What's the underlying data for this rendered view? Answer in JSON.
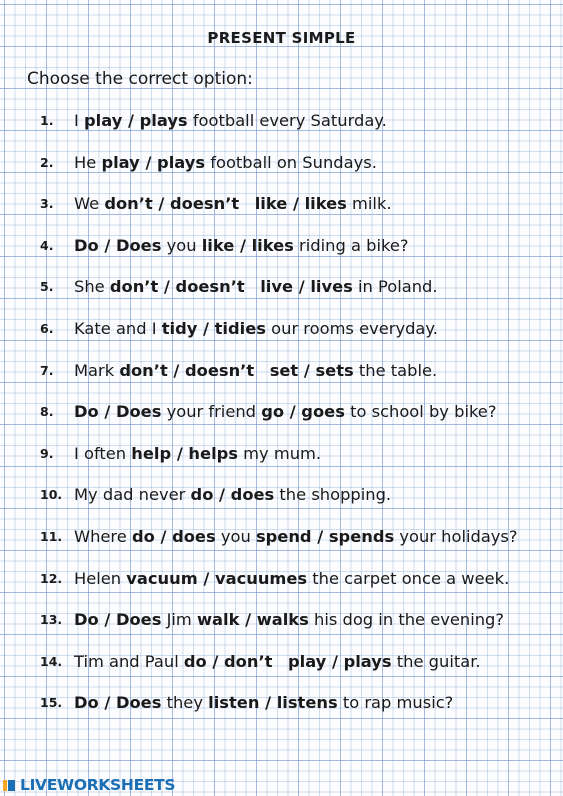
{
  "title": "PRESENT SIMPLE",
  "instruction": "Choose the correct option:",
  "exercises": [
    {
      "num": "1.",
      "parts": [
        {
          "t": "I "
        },
        {
          "t": "play / plays",
          "b": true
        },
        {
          "t": " football every Saturday."
        }
      ]
    },
    {
      "num": "2.",
      "parts": [
        {
          "t": "He "
        },
        {
          "t": "play / plays",
          "b": true
        },
        {
          "t": " football on Sundays."
        }
      ]
    },
    {
      "num": "3.",
      "parts": [
        {
          "t": "We "
        },
        {
          "t": "don’t / doesn’t",
          "b": true
        },
        {
          "t": "   "
        },
        {
          "t": "like / likes",
          "b": true
        },
        {
          "t": " milk."
        }
      ]
    },
    {
      "num": "4.",
      "parts": [
        {
          "t": "Do / Does",
          "b": true
        },
        {
          "t": " you "
        },
        {
          "t": "like / likes",
          "b": true
        },
        {
          "t": " riding a bike?"
        }
      ]
    },
    {
      "num": "5.",
      "parts": [
        {
          "t": "She "
        },
        {
          "t": "don’t / doesn’t",
          "b": true
        },
        {
          "t": "   "
        },
        {
          "t": "live / lives",
          "b": true
        },
        {
          "t": " in Poland."
        }
      ]
    },
    {
      "num": "6.",
      "parts": [
        {
          "t": "Kate and I "
        },
        {
          "t": "tidy / tidies",
          "b": true
        },
        {
          "t": " our rooms everyday."
        }
      ]
    },
    {
      "num": "7.",
      "parts": [
        {
          "t": "Mark "
        },
        {
          "t": "don’t / doesn’t",
          "b": true
        },
        {
          "t": "   "
        },
        {
          "t": "set / sets",
          "b": true
        },
        {
          "t": " the table."
        }
      ]
    },
    {
      "num": "8.",
      "parts": [
        {
          "t": "Do / Does",
          "b": true
        },
        {
          "t": " your friend "
        },
        {
          "t": "go / goes",
          "b": true
        },
        {
          "t": " to school by bike?"
        }
      ]
    },
    {
      "num": "9.",
      "parts": [
        {
          "t": "I often "
        },
        {
          "t": "help / helps",
          "b": true
        },
        {
          "t": " my mum."
        }
      ]
    },
    {
      "num": "10.",
      "parts": [
        {
          "t": "My dad never "
        },
        {
          "t": "do / does",
          "b": true
        },
        {
          "t": " the shopping."
        }
      ]
    },
    {
      "num": "11.",
      "parts": [
        {
          "t": "Where "
        },
        {
          "t": "do / does",
          "b": true
        },
        {
          "t": " you "
        },
        {
          "t": "spend / spends",
          "b": true
        },
        {
          "t": " your holidays?"
        }
      ]
    },
    {
      "num": "12.",
      "parts": [
        {
          "t": "Helen "
        },
        {
          "t": "vacuum / vacuumes",
          "b": true
        },
        {
          "t": " the carpet once a week."
        }
      ]
    },
    {
      "num": "13.",
      "parts": [
        {
          "t": "Do / Does",
          "b": true
        },
        {
          "t": " Jim "
        },
        {
          "t": "walk / walks",
          "b": true
        },
        {
          "t": " his dog in the evening?"
        }
      ]
    },
    {
      "num": "14.",
      "parts": [
        {
          "t": "Tim and Paul "
        },
        {
          "t": "do / don’t",
          "b": true
        },
        {
          "t": "   "
        },
        {
          "t": "play / plays",
          "b": true
        },
        {
          "t": " the guitar."
        }
      ]
    },
    {
      "num": "15.",
      "parts": [
        {
          "t": "Do / Does",
          "b": true
        },
        {
          "t": " they "
        },
        {
          "t": "listen / listens",
          "b": true
        },
        {
          "t": " to rap music?"
        }
      ]
    }
  ],
  "brand": "LIVEWORKSHEETS",
  "colors": {
    "grid": "#8cb0dc",
    "brand_blue": "#1b6fb4",
    "brand_orange": "#f6a623",
    "text": "#1a1a1a"
  }
}
